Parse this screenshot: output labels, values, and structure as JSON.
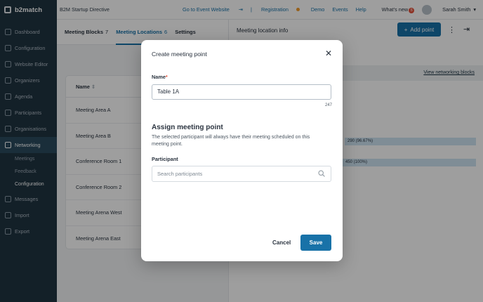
{
  "brand": "b2match",
  "event_name": "B2M Startup Directive",
  "topnav": {
    "go_to_event": "Go to Event Website",
    "registration": "Registration",
    "demo": "Demo",
    "events": "Events",
    "help": "Help",
    "whats_new": "What's new",
    "whats_new_count": "5",
    "user_name": "Sarah Smith"
  },
  "sidebar": {
    "items": [
      {
        "label": "Dashboard",
        "icon": "dashboard-icon"
      },
      {
        "label": "Configuration",
        "icon": "settings-icon"
      },
      {
        "label": "Website Editor",
        "icon": "editor-icon"
      },
      {
        "label": "Organizers",
        "icon": "organizers-icon"
      },
      {
        "label": "Agenda",
        "icon": "calendar-icon"
      },
      {
        "label": "Participants",
        "icon": "participants-icon"
      },
      {
        "label": "Organisations",
        "icon": "building-icon"
      },
      {
        "label": "Networking",
        "icon": "networking-icon"
      }
    ],
    "sub_items": [
      "Meetings",
      "Feedback",
      "Configuration"
    ],
    "items_after": [
      {
        "label": "Messages",
        "icon": "mail-icon"
      },
      {
        "label": "Import",
        "icon": "import-icon"
      },
      {
        "label": "Export",
        "icon": "export-icon"
      }
    ]
  },
  "tabs": [
    {
      "label": "Meeting Blocks",
      "count": "7"
    },
    {
      "label": "Meeting Locations",
      "count": "6"
    },
    {
      "label": "Settings",
      "count": ""
    }
  ],
  "table": {
    "header": "Name",
    "rows": [
      "Meeting Area A",
      "Meeting Area B",
      "Conference Room 1",
      "Conference Room 2",
      "Meeting Arena West",
      "Meeting Arena East"
    ]
  },
  "right_panel": {
    "title": "Meeting location info",
    "add_button": "Add point",
    "link": "View networking blocks",
    "bars": [
      "290 (96.67%)",
      "450 (100%)"
    ]
  },
  "modal": {
    "title": "Create meeting point",
    "name_label": "Name",
    "name_value": "Table 1A",
    "char_count": "247",
    "section_title": "Assign meeting point",
    "description": "The selected participant will always have their meeting scheduled on this meeting point.",
    "participant_label": "Participant",
    "search_placeholder": "Search participants",
    "cancel": "Cancel",
    "save": "Save"
  },
  "colors": {
    "primary": "#1872a8",
    "sidebar": "#1f3442",
    "accent": "#e5533d"
  }
}
